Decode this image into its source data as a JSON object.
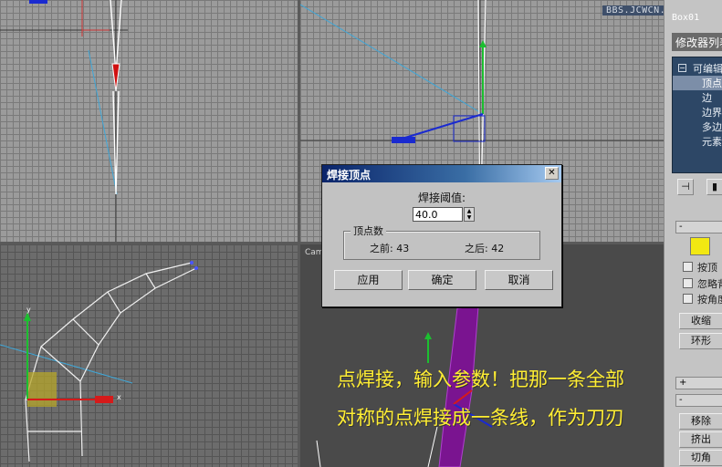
{
  "watermark": "BBS.JCWCN.COM",
  "viewports": {
    "perspective_label": "Cam"
  },
  "dialog": {
    "title": "焊接顶点",
    "close_label": "✕",
    "threshold_label": "焊接阈值:",
    "threshold_value": "40.0",
    "vertex_group_label": "顶点数",
    "before_label": "之前: 43",
    "after_label": "之后: 42",
    "apply_label": "应用",
    "ok_label": "确定",
    "cancel_label": "取消"
  },
  "caption": {
    "line1": "点焊接，输入参数！把那一条全部",
    "line2": "对称的点焊接成一条线，作为刀刃"
  },
  "command_panel": {
    "object_name": "Box01",
    "modifier_list_label": "修改器列表",
    "stack": {
      "root_label": "可编辑",
      "items": [
        "顶点",
        "边",
        "边界",
        "多边",
        "元素"
      ],
      "selected_index": 0
    },
    "rollout_minus": "-",
    "rollout_plus": "+",
    "checkbox_labels": [
      "按顶",
      "忽略背",
      "按角度"
    ],
    "buttons": [
      "收缩",
      "环形",
      "移除",
      "挤出",
      "切角"
    ]
  }
}
